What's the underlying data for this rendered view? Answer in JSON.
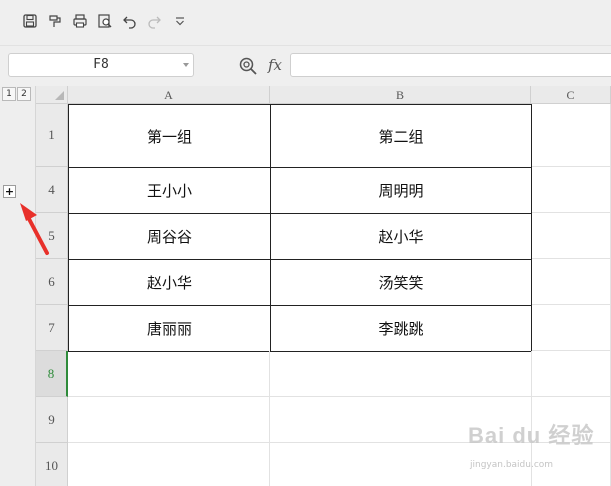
{
  "toolbar": {
    "icons": [
      "save-icon",
      "format-painter-icon",
      "print-icon",
      "print-preview-icon",
      "undo-icon",
      "redo-icon",
      "more-dropdown-icon"
    ]
  },
  "formula_bar": {
    "cell_reference": "F8",
    "fx_label": "fx",
    "formula_value": ""
  },
  "outline": {
    "level_1": "1",
    "level_2": "2",
    "expand_symbol": "+",
    "arrow_color": "#e8302a"
  },
  "columns": [
    "A",
    "B",
    "C"
  ],
  "rows": [
    {
      "num": "1",
      "a": "第一组",
      "b": "第二组"
    },
    {
      "num": "4",
      "a": "王小小",
      "b": "周明明"
    },
    {
      "num": "5",
      "a": "周谷谷",
      "b": "赵小华"
    },
    {
      "num": "6",
      "a": "赵小华",
      "b": "汤笑笑"
    },
    {
      "num": "7",
      "a": "唐丽丽",
      "b": "李跳跳"
    },
    {
      "num": "8",
      "a": "",
      "b": ""
    },
    {
      "num": "9",
      "a": "",
      "b": ""
    },
    {
      "num": "10",
      "a": "",
      "b": ""
    }
  ],
  "active_row": "8",
  "active_color": "#2e8b3a",
  "watermark": {
    "text": "Bai du 经验",
    "sub": "jingyan.baidu.com"
  }
}
